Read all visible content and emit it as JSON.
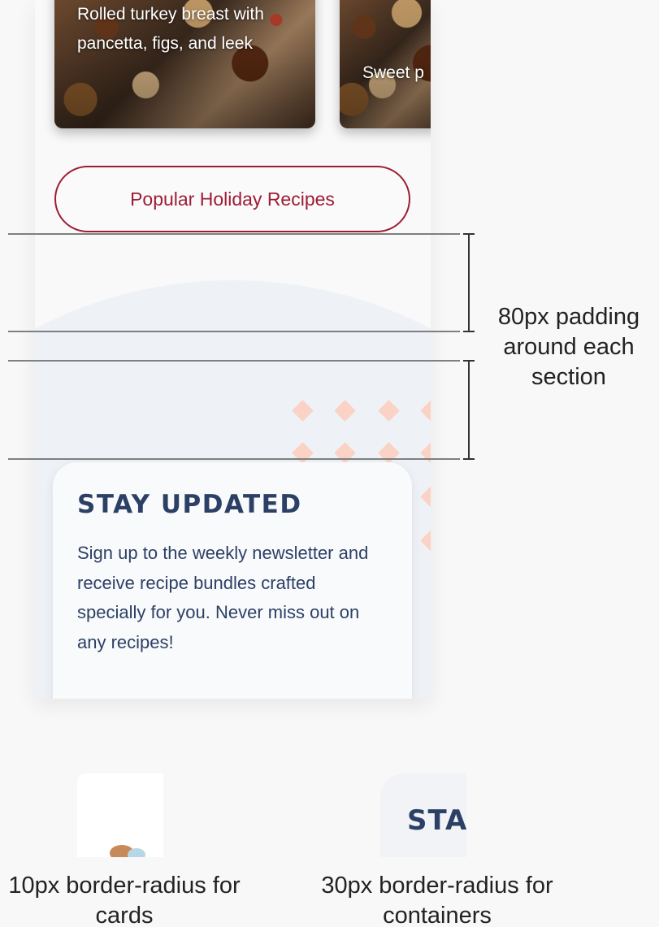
{
  "recipes": {
    "cards": [
      {
        "title": "Rolled turkey breast with pancetta, figs, and leek"
      },
      {
        "title": "Sweet p"
      }
    ],
    "popular_button_label": "Popular Holiday Recipes"
  },
  "newsletter": {
    "title": "STAY UPDATED",
    "body": "Sign up to the weekly newsletter and receive recipe bundles crafted specially for you. Never miss out on any recipes!"
  },
  "annotations": {
    "padding": "80px padding around each section",
    "cards_radius": "10px border-radius for cards",
    "containers_radius": "30px border-radius for containers"
  },
  "samples": {
    "container_text": "STA"
  },
  "colors": {
    "accent": "#9e1d35",
    "heading": "#2c4066",
    "section_bg": "#eef2f6",
    "diamond": "#fbd3c6"
  }
}
